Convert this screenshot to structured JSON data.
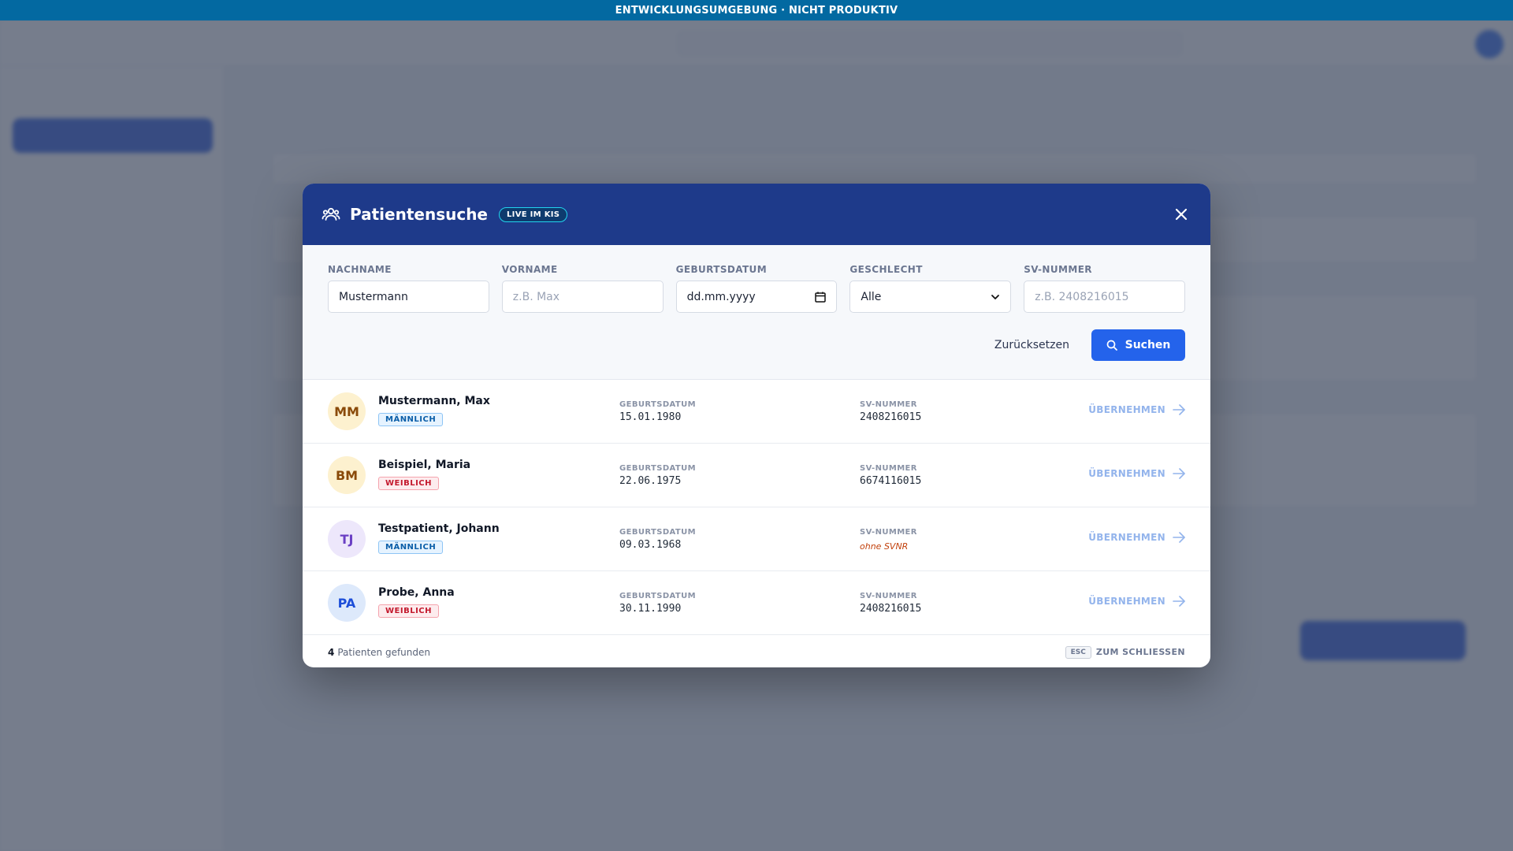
{
  "env_banner": "ENTWICKLUNGSUMGEBUNG · NICHT PRODUKTIV",
  "modal": {
    "title": "Patientensuche",
    "badge": "LIVE IM KIS",
    "fields": {
      "nachname": {
        "label": "NACHNAME",
        "value": "Mustermann"
      },
      "vorname": {
        "label": "VORNAME",
        "placeholder": "z.B. Max"
      },
      "geburtsdatum": {
        "label": "GEBURTSDATUM",
        "value": "dd.mm.yyyy"
      },
      "geschlecht": {
        "label": "GESCHLECHT",
        "value": "Alle"
      },
      "svnummer": {
        "label": "SV-NUMMER",
        "placeholder": "z.B. 2408216015"
      }
    },
    "reset_label": "Zurücksetzen",
    "search_label": "Suchen",
    "col_birth_label": "GEBURTSDATUM",
    "col_sv_label": "SV-NUMMER",
    "apply_label": "ÜBERNEHMEN",
    "patients": [
      {
        "initials": "MM",
        "name": "Mustermann, Max",
        "gender": "MÄNNLICH",
        "birth": "15.01.1980",
        "sv": "2408216015"
      },
      {
        "initials": "BM",
        "name": "Beispiel, Maria",
        "gender": "WEIBLICH",
        "birth": "22.06.1975",
        "sv": "6674116015"
      },
      {
        "initials": "TJ",
        "name": "Testpatient, Johann",
        "gender": "MÄNNLICH",
        "birth": "09.03.1968",
        "sv": "ohne SVNR"
      },
      {
        "initials": "PA",
        "name": "Probe, Anna",
        "gender": "WEIBLICH",
        "birth": "30.11.1990",
        "sv": "2408216015"
      }
    ],
    "footer": {
      "count": "4",
      "count_text": "Patienten gefunden",
      "esc_key": "ESC",
      "esc_text": "ZUM SCHLIESSEN"
    }
  },
  "colors": {
    "header": "#1e3a8a",
    "primary": "#2463eb",
    "banner": "#0369a1",
    "male_badge": "#0b5ea8",
    "female_badge": "#c3192d"
  }
}
